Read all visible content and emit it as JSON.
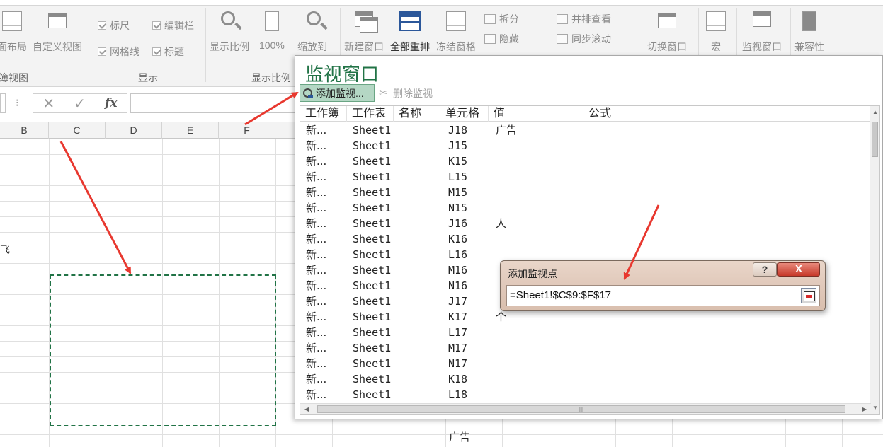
{
  "ribbon": {
    "buttons": {
      "page_layout": "面布局",
      "custom_views": "自定义视图",
      "zoom": "显示比例",
      "zoom_100": "100%",
      "zoom_to_selection": "缩放到",
      "new_window": "新建窗口",
      "arrange_all": "全部重排",
      "freeze_panes": "冻结窗格",
      "switch_windows": "切换窗口",
      "macros": "宏",
      "watch_window": "监视窗口",
      "compatibility": "兼容性"
    },
    "checkboxes": {
      "ruler": "标尺",
      "formula_bar": "编辑栏",
      "gridlines": "网格线",
      "headings": "标题"
    },
    "window_items": {
      "split": "拆分",
      "hide": "隐藏",
      "view_side_by_side": "并排查看",
      "sync_scroll": "同步滚动"
    },
    "group_labels": {
      "workbook_views": "簿视图",
      "show": "显示",
      "zoom": "显示比例"
    }
  },
  "formula_bar": {
    "dots": "⁝",
    "cancel": "✕",
    "enter": "✓",
    "fx": "fx"
  },
  "sheet": {
    "columns": [
      "B",
      "C",
      "D",
      "E",
      "F"
    ],
    "cell_text_fei": "飞",
    "cell_text_ad": "广告"
  },
  "watch_window": {
    "title": "监视窗口",
    "add_watch": "添加监视...",
    "delete_watch": "删除监视",
    "headers": [
      "工作簿",
      "工作表",
      "名称",
      "单元格",
      "值",
      "公式"
    ],
    "rows": [
      {
        "book": "新...",
        "sheet": "Sheet1",
        "cell": "J18",
        "value": "广告"
      },
      {
        "book": "新...",
        "sheet": "Sheet1",
        "cell": "J15",
        "value": ""
      },
      {
        "book": "新...",
        "sheet": "Sheet1",
        "cell": "K15",
        "value": ""
      },
      {
        "book": "新...",
        "sheet": "Sheet1",
        "cell": "L15",
        "value": ""
      },
      {
        "book": "新...",
        "sheet": "Sheet1",
        "cell": "M15",
        "value": ""
      },
      {
        "book": "新...",
        "sheet": "Sheet1",
        "cell": "N15",
        "value": ""
      },
      {
        "book": "新...",
        "sheet": "Sheet1",
        "cell": "J16",
        "value": "人"
      },
      {
        "book": "新...",
        "sheet": "Sheet1",
        "cell": "K16",
        "value": ""
      },
      {
        "book": "新...",
        "sheet": "Sheet1",
        "cell": "L16",
        "value": ""
      },
      {
        "book": "新...",
        "sheet": "Sheet1",
        "cell": "M16",
        "value": ""
      },
      {
        "book": "新...",
        "sheet": "Sheet1",
        "cell": "N16",
        "value": ""
      },
      {
        "book": "新...",
        "sheet": "Sheet1",
        "cell": "J17",
        "value": ""
      },
      {
        "book": "新...",
        "sheet": "Sheet1",
        "cell": "K17",
        "value": "个"
      },
      {
        "book": "新...",
        "sheet": "Sheet1",
        "cell": "L17",
        "value": ""
      },
      {
        "book": "新...",
        "sheet": "Sheet1",
        "cell": "M17",
        "value": ""
      },
      {
        "book": "新...",
        "sheet": "Sheet1",
        "cell": "N17",
        "value": ""
      },
      {
        "book": "新...",
        "sheet": "Sheet1",
        "cell": "K18",
        "value": ""
      },
      {
        "book": "新...",
        "sheet": "Sheet1",
        "cell": "L18",
        "value": ""
      }
    ]
  },
  "dialog": {
    "title": "添加监视点",
    "help": "?",
    "close": "X",
    "reference": "=Sheet1!$C$9:$F$17"
  },
  "colors": {
    "accent_green": "#217346",
    "arrow_red": "#e8382f",
    "button_highlight": "#b4d7c4"
  }
}
